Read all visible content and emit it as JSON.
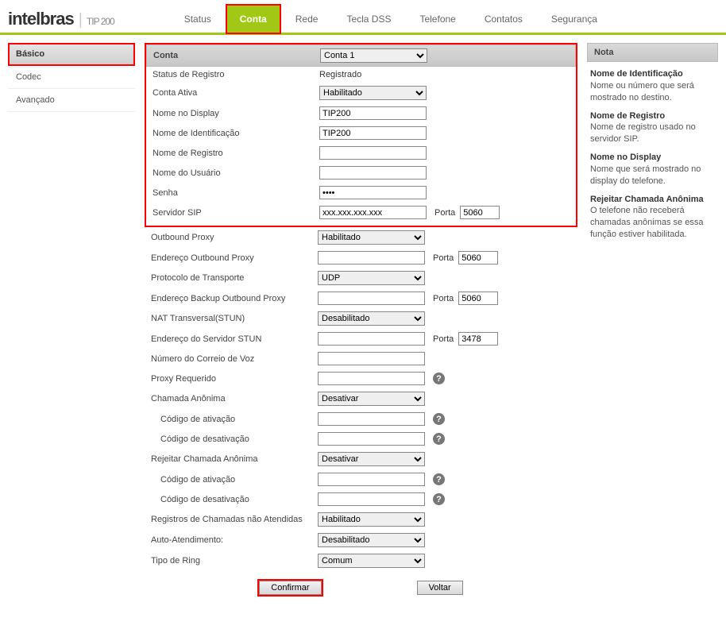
{
  "brand": {
    "name": "intelbras",
    "model": "TIP 200"
  },
  "topnav": [
    {
      "label": "Status",
      "active": false
    },
    {
      "label": "Conta",
      "active": true,
      "highlighted": true
    },
    {
      "label": "Rede",
      "active": false
    },
    {
      "label": "Tecla DSS",
      "active": false
    },
    {
      "label": "Telefone",
      "active": false
    },
    {
      "label": "Contatos",
      "active": false
    },
    {
      "label": "Segurança",
      "active": false
    }
  ],
  "sidebar": [
    {
      "label": "Básico",
      "active": true,
      "highlighted": true
    },
    {
      "label": "Codec",
      "active": false
    },
    {
      "label": "Avançado",
      "active": false
    }
  ],
  "account_header_label": "Conta",
  "account_selected": "Conta 1",
  "fields": {
    "status_registro": {
      "label": "Status de Registro",
      "value": "Registrado"
    },
    "conta_ativa": {
      "label": "Conta Ativa",
      "value": "Habilitado"
    },
    "nome_display": {
      "label": "Nome no Display",
      "value": "TIP200"
    },
    "nome_ident": {
      "label": "Nome de Identificação",
      "value": "TIP200"
    },
    "nome_registro": {
      "label": "Nome de Registro",
      "value": ""
    },
    "nome_usuario": {
      "label": "Nome do Usuário",
      "value": ""
    },
    "senha": {
      "label": "Senha",
      "value": "••••"
    },
    "servidor_sip": {
      "label": "Servidor SIP",
      "value": "xxx.xxx.xxx.xxx",
      "porta_label": "Porta",
      "porta": "5060"
    },
    "outbound_proxy": {
      "label": "Outbound Proxy",
      "value": "Habilitado"
    },
    "end_outbound_proxy": {
      "label": "Endereço Outbound Proxy",
      "value": "",
      "porta_label": "Porta",
      "porta": "5060"
    },
    "protocolo_transporte": {
      "label": "Protocolo de Transporte",
      "value": "UDP"
    },
    "end_backup_outbound": {
      "label": "Endereço Backup Outbound Proxy",
      "value": "",
      "porta_label": "Porta",
      "porta": "5060"
    },
    "nat_transversal": {
      "label": "NAT Transversal(STUN)",
      "value": "Desabilitado"
    },
    "end_servidor_stun": {
      "label": "Endereço do Servidor STUN",
      "value": "",
      "porta_label": "Porta",
      "porta": "3478"
    },
    "numero_correio": {
      "label": "Número do Correio de Voz",
      "value": ""
    },
    "proxy_requerido": {
      "label": "Proxy Requerido",
      "value": ""
    },
    "chamada_anonima": {
      "label": "Chamada Anônima",
      "value": "Desativar"
    },
    "ca_cod_ativ": {
      "label": "Código de ativação",
      "value": ""
    },
    "ca_cod_desativ": {
      "label": "Código de desativação",
      "value": ""
    },
    "rejeitar_anonima": {
      "label": "Rejeitar Chamada Anônima",
      "value": "Desativar"
    },
    "ra_cod_ativ": {
      "label": "Código de ativação",
      "value": ""
    },
    "ra_cod_desativ": {
      "label": "Código de desativação",
      "value": ""
    },
    "reg_nao_atendidas": {
      "label": "Registros de Chamadas não Atendidas",
      "value": "Habilitado"
    },
    "auto_atendimento": {
      "label": "Auto-Atendimento:",
      "value": "Desabilitado"
    },
    "tipo_ring": {
      "label": "Tipo de Ring",
      "value": "Comum"
    }
  },
  "buttons": {
    "confirmar": "Confirmar",
    "voltar": "Voltar"
  },
  "note": {
    "title": "Nota",
    "items": [
      {
        "heading": "Nome de Identificação",
        "text": "Nome ou número que será mostrado no destino."
      },
      {
        "heading": "Nome de Registro",
        "text": "Nome de registro usado no servidor SIP."
      },
      {
        "heading": "Nome no Display",
        "text": "Nome que será mostrado no display do telefone."
      },
      {
        "heading": "Rejeitar Chamada Anônima",
        "text": "O telefone não receberá chamadas anônimas se essa função estiver habilitada."
      }
    ]
  }
}
